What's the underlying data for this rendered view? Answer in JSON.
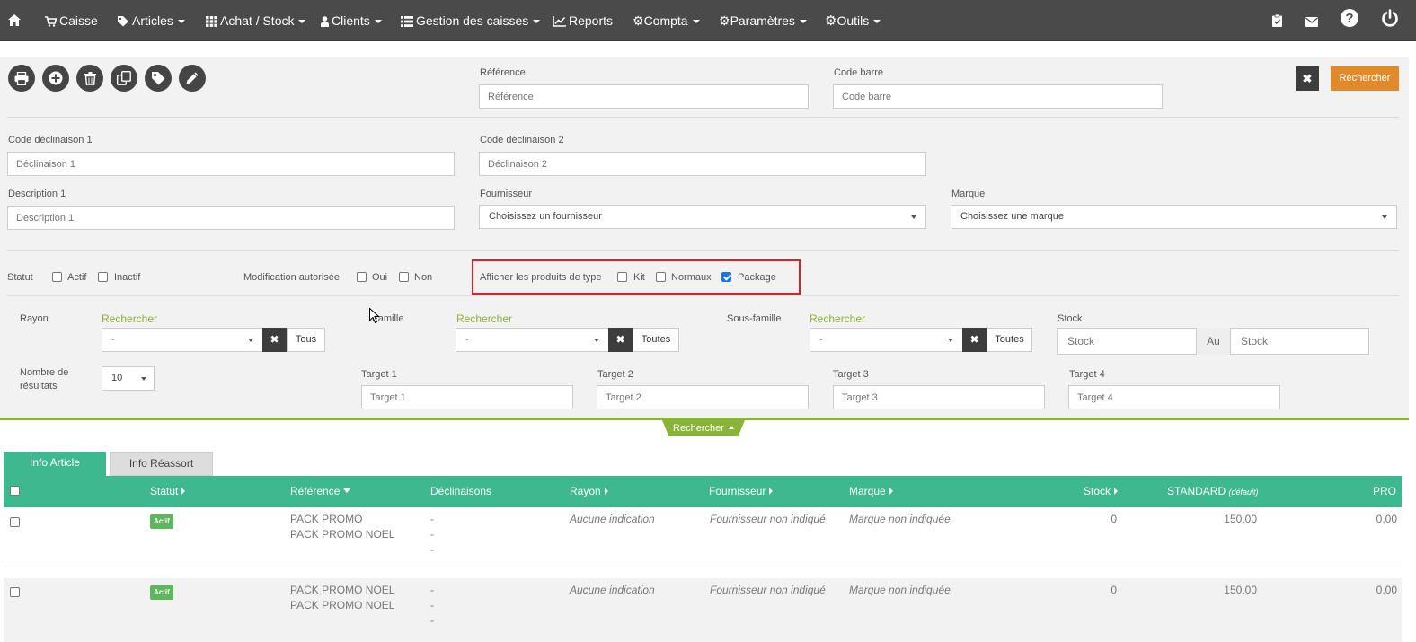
{
  "nav": {
    "items": [
      {
        "label": "Caisse",
        "has_caret": false
      },
      {
        "label": "Articles",
        "has_caret": true
      },
      {
        "label": "Achat / Stock",
        "has_caret": true
      },
      {
        "label": "Clients",
        "has_caret": true
      },
      {
        "label": "Gestion des caisses",
        "has_caret": true
      },
      {
        "label": "Reports",
        "has_caret": false
      },
      {
        "label": "Compta",
        "has_caret": true
      },
      {
        "label": "Paramètres",
        "has_caret": true
      },
      {
        "label": "Outils",
        "has_caret": true
      }
    ],
    "right_icons": [
      "clipboard-check-icon",
      "envelope-icon",
      "help-icon",
      "power-icon"
    ]
  },
  "toolbar": {
    "icons": [
      "print-icon",
      "add-icon",
      "delete-icon",
      "duplicate-icon",
      "tag-icon",
      "edit-icon"
    ]
  },
  "filters": {
    "reference": {
      "label": "Référence",
      "placeholder": "Référence"
    },
    "barcode": {
      "label": "Code barre",
      "placeholder": "Code barre"
    },
    "search_button": "Rechercher",
    "clear_icon": "close-icon",
    "declinaison1": {
      "label": "Code déclinaison 1",
      "placeholder": "Déclinaison 1"
    },
    "declinaison2": {
      "label": "Code déclinaison 2",
      "placeholder": "Déclinaison 2"
    },
    "description1": {
      "label": "Description 1",
      "placeholder": "Description 1"
    },
    "supplier": {
      "label": "Fournisseur",
      "value": "Choisissez un fournisseur"
    },
    "brand": {
      "label": "Marque",
      "value": "Choisissez une marque"
    },
    "status": {
      "label": "Statut",
      "options": [
        {
          "label": "Actif",
          "checked": false
        },
        {
          "label": "Inactif",
          "checked": false
        }
      ]
    },
    "modification": {
      "label": "Modification autorisée",
      "options": [
        {
          "label": "Oui",
          "checked": false
        },
        {
          "label": "Non",
          "checked": false
        }
      ]
    },
    "product_type": {
      "label": "Afficher les produits de type",
      "options": [
        {
          "label": "Kit",
          "checked": false
        },
        {
          "label": "Normaux",
          "checked": false
        },
        {
          "label": "Package",
          "checked": true
        }
      ]
    },
    "rayon": {
      "label": "Rayon",
      "search_link": "Rechercher",
      "value": "-",
      "all_button": "Tous"
    },
    "famille": {
      "label": "Famille",
      "search_link": "Rechercher",
      "value": "-",
      "all_button": "Toutes"
    },
    "sous_famille": {
      "label": "Sous-famille",
      "search_link": "Rechercher",
      "value": "-",
      "all_button": "Toutes"
    },
    "stock": {
      "label": "Stock",
      "from_placeholder": "Stock",
      "to_label": "Au",
      "to_placeholder": "Stock"
    },
    "results": {
      "label_line1": "Nombre de",
      "label_line2": "résultats",
      "value": "10"
    },
    "target1": {
      "label": "Target 1",
      "placeholder": "Target 1"
    },
    "target2": {
      "label": "Target 2",
      "placeholder": "Target 2"
    },
    "target3": {
      "label": "Target 3",
      "placeholder": "Target 3"
    },
    "target4": {
      "label": "Target 4",
      "placeholder": "Target 4"
    },
    "toggle_label": "Rechercher"
  },
  "tabs": [
    {
      "label": "Info Article",
      "active": true
    },
    {
      "label": "Info Réassort",
      "active": false
    }
  ],
  "table": {
    "headers": {
      "statut": "Statut",
      "reference": "Référence",
      "declinaisons": "Déclinaisons",
      "rayon": "Rayon",
      "fournisseur": "Fournisseur",
      "marque": "Marque",
      "stock": "Stock",
      "standard": "STANDARD",
      "standard_note": "(défault)",
      "pro": "PRO"
    },
    "rows": [
      {
        "statut": "Actif",
        "ref_line1": "PACK PROMO",
        "ref_line2": "PACK PROMO NOEL",
        "decl": [
          "-",
          "-",
          "-"
        ],
        "rayon": "Aucune indication",
        "fournisseur": "Fournisseur non indiqué",
        "marque": "Marque non indiquée",
        "stock": "0",
        "standard": "150,00",
        "pro": "0,00"
      },
      {
        "statut": "Actif",
        "ref_line1": "PACK PROMO NOEL",
        "ref_line2": "PACK PROMO NOEL",
        "decl": [
          "-",
          "-",
          "-"
        ],
        "rayon": "Aucune indication",
        "fournisseur": "Fournisseur non indiqué",
        "marque": "Marque non indiquée",
        "stock": "0",
        "standard": "150,00",
        "pro": "0,00"
      }
    ]
  },
  "colors": {
    "navbar": "#4a4a4a",
    "table_header": "#3db88f",
    "accent_green": "#8ab33a",
    "search_button": "#e08a2c",
    "highlight": "#e02020"
  }
}
